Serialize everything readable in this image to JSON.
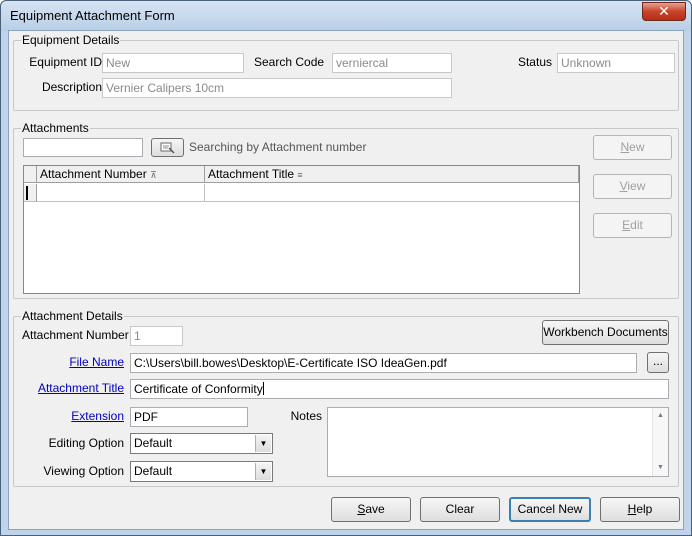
{
  "window": {
    "title": "Equipment Attachment Form",
    "close_glyph": "✕"
  },
  "equipment_details": {
    "group_label": "Equipment Details",
    "equipment_id_label": "Equipment ID",
    "equipment_id_value": "New",
    "search_code_label": "Search Code",
    "search_code_value": "verniercal",
    "status_label": "Status",
    "status_value": "Unknown",
    "description_label": "Description",
    "description_value": "Vernier Calipers 10cm"
  },
  "attachments": {
    "group_label": "Attachments",
    "search_value": "",
    "search_hint": "Searching by Attachment number",
    "columns": [
      "Attachment Number",
      "Attachment Title"
    ],
    "new_label_u": "N",
    "new_label_rest": "ew",
    "view_label_u": "V",
    "view_label_rest": "iew",
    "edit_label_u": "E",
    "edit_label_rest": "dit"
  },
  "attachment_details": {
    "group_label": "Attachment Details",
    "number_label": "Attachment Number",
    "number_value": "1",
    "workbench_label": "Workbench Documents",
    "file_name_label": "File Name",
    "file_name_value": "C:\\Users\\bill.bowes\\Desktop\\E-Certificate ISO IdeaGen.pdf",
    "browse_label": "...",
    "title_label": "Attachment Title",
    "title_value": "Certificate of Conformity",
    "extension_label": "Extension",
    "extension_value": "PDF",
    "notes_label": "Notes",
    "notes_value": "",
    "editing_label": "Editing Option",
    "editing_value": "Default",
    "viewing_label": "Viewing Option",
    "viewing_value": "Default"
  },
  "footer": {
    "save_u": "S",
    "save_rest": "ave",
    "clear_label": "Clear",
    "cancel_label": "Cancel New",
    "help_u": "H",
    "help_rest": "elp"
  }
}
